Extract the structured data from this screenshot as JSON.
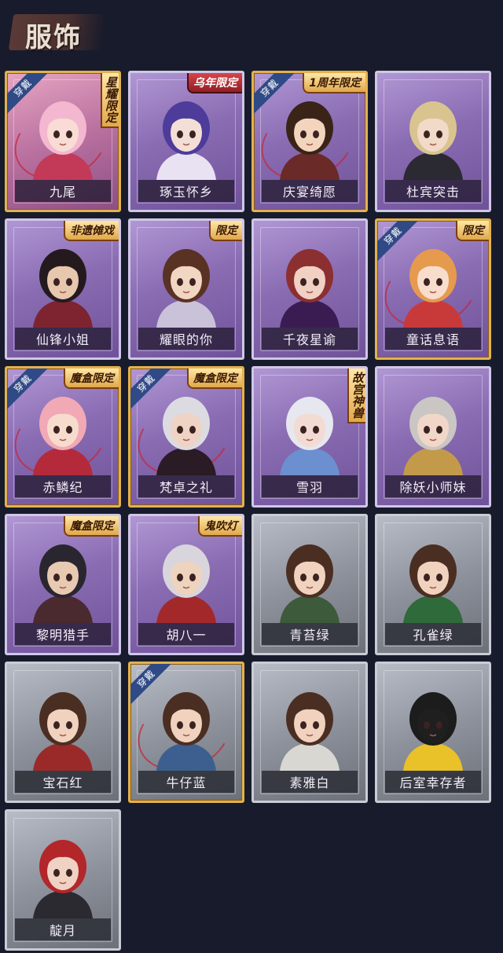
{
  "header": {
    "title": "服饰"
  },
  "labels": {
    "equipped": "穿戴"
  },
  "items": [
    {
      "name": "九尾",
      "badge": "星耀限定",
      "badge_style": "vert",
      "equipped": true,
      "theme": "pink",
      "hair": "#f3b7cf",
      "skin": "#f8dcd5",
      "cloth": "#c23a58"
    },
    {
      "name": "琢玉怀乡",
      "badge": "乌年限定",
      "badge_style": "red",
      "equipped": false,
      "theme": "purple",
      "hair": "#4d3c9a",
      "skin": "#f4dfd6",
      "cloth": "#e9e2f2"
    },
    {
      "name": "庆宴绮愿",
      "badge": "1周年限定",
      "badge_style": "gold",
      "equipped": true,
      "theme": "purple",
      "hair": "#3a2418",
      "skin": "#f3d4bd",
      "cloth": "#6a2a28"
    },
    {
      "name": "杜宾突击",
      "badge": "",
      "badge_style": "",
      "equipped": false,
      "theme": "purple",
      "hair": "#d9c48f",
      "skin": "#f1dac7",
      "cloth": "#2b2a33"
    },
    {
      "name": "仙锋小姐",
      "badge": "非遗傩戏",
      "badge_style": "gold",
      "equipped": false,
      "theme": "purple",
      "hair": "#241a1e",
      "skin": "#e7c7ad",
      "cloth": "#7d2430"
    },
    {
      "name": "耀眼的你",
      "badge": "限定",
      "badge_style": "gold",
      "equipped": false,
      "theme": "purple",
      "hair": "#5a3224",
      "skin": "#f1d6c3",
      "cloth": "#c9c2d8"
    },
    {
      "name": "千夜星谕",
      "badge": "",
      "badge_style": "",
      "equipped": false,
      "theme": "purple",
      "hair": "#8c2f30",
      "skin": "#f0d1c4",
      "cloth": "#3b1c52"
    },
    {
      "name": "童话息语",
      "badge": "限定",
      "badge_style": "gold",
      "equipped": true,
      "theme": "purple",
      "hair": "#e69a4e",
      "skin": "#f8ddcc",
      "cloth": "#c83a3a"
    },
    {
      "name": "赤鳞纪",
      "badge": "魔盒限定",
      "badge_style": "gold",
      "equipped": true,
      "theme": "purple",
      "hair": "#f2a9b6",
      "skin": "#f7dccd",
      "cloth": "#b42a3a"
    },
    {
      "name": "梵卓之礼",
      "badge": "魔盒限定",
      "badge_style": "gold",
      "equipped": true,
      "theme": "purple",
      "hair": "#dcdbe2",
      "skin": "#efd3c4",
      "cloth": "#2a1b24"
    },
    {
      "name": "雪羽",
      "badge": "故宫神兽",
      "badge_style": "vert",
      "equipped": false,
      "theme": "purple",
      "hair": "#e6e7ef",
      "skin": "#f2dbd3",
      "cloth": "#6c8fcf"
    },
    {
      "name": "除妖小师妹",
      "badge": "",
      "badge_style": "",
      "equipped": false,
      "theme": "purple",
      "hair": "#c9c6c4",
      "skin": "#f0d7c7",
      "cloth": "#c39a4a"
    },
    {
      "name": "黎明猎手",
      "badge": "魔盒限定",
      "badge_style": "gold",
      "equipped": false,
      "theme": "purple",
      "hair": "#2a2630",
      "skin": "#e8c9b2",
      "cloth": "#4a2a2e"
    },
    {
      "name": "胡八一",
      "badge": "鬼吹灯",
      "badge_style": "gold",
      "equipped": false,
      "theme": "purple",
      "hair": "#d8d6dc",
      "skin": "#eed3bf",
      "cloth": "#a3282a"
    },
    {
      "name": "青苔绿",
      "badge": "",
      "badge_style": "",
      "equipped": false,
      "theme": "gray",
      "hair": "#4b2e22",
      "skin": "#f0d2be",
      "cloth": "#3d5a3a"
    },
    {
      "name": "孔雀绿",
      "badge": "",
      "badge_style": "",
      "equipped": false,
      "theme": "gray",
      "hair": "#4b2e22",
      "skin": "#f0d2be",
      "cloth": "#2f6a3a"
    },
    {
      "name": "宝石红",
      "badge": "",
      "badge_style": "",
      "equipped": false,
      "theme": "gray",
      "hair": "#4b2e22",
      "skin": "#f0d2be",
      "cloth": "#9a2a2a"
    },
    {
      "name": "牛仔蓝",
      "badge": "",
      "badge_style": "",
      "equipped": true,
      "theme": "gray",
      "hair": "#4b2e22",
      "skin": "#f0d2be",
      "cloth": "#3d5f8f"
    },
    {
      "name": "素雅白",
      "badge": "",
      "badge_style": "",
      "equipped": false,
      "theme": "gray",
      "hair": "#4b2e22",
      "skin": "#f0d2be",
      "cloth": "#d8d7d2"
    },
    {
      "name": "后室幸存者",
      "badge": "",
      "badge_style": "",
      "equipped": false,
      "theme": "gray",
      "hair": "#1c1c1c",
      "skin": "#1f1f1f",
      "cloth": "#e9c128"
    },
    {
      "name": "靛月",
      "badge": "",
      "badge_style": "",
      "equipped": false,
      "theme": "gray",
      "hair": "#b3262a",
      "skin": "#f0d2c4",
      "cloth": "#2a2a30"
    }
  ]
}
